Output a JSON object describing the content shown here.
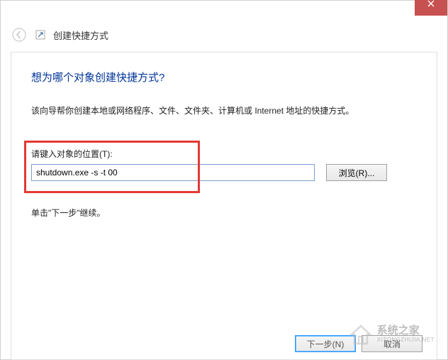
{
  "window": {
    "wizard_name": "创建快捷方式"
  },
  "page": {
    "headline": "想为哪个对象创建快捷方式?",
    "intro": "该向导帮你创建本地或网络程序、文件、文件夹、计算机或 Internet 地址的快捷方式。",
    "input_label": "请键入对象的位置(T):",
    "input_value": "shutdown.exe -s -t 00",
    "browse_label": "浏览(R)...",
    "continue_text": "单击\"下一步\"继续。"
  },
  "footer": {
    "next": "下一步(N)",
    "cancel": "取消"
  },
  "watermark": {
    "line1": "系统之家",
    "line2": "XITONGZHIJIA.NET"
  }
}
